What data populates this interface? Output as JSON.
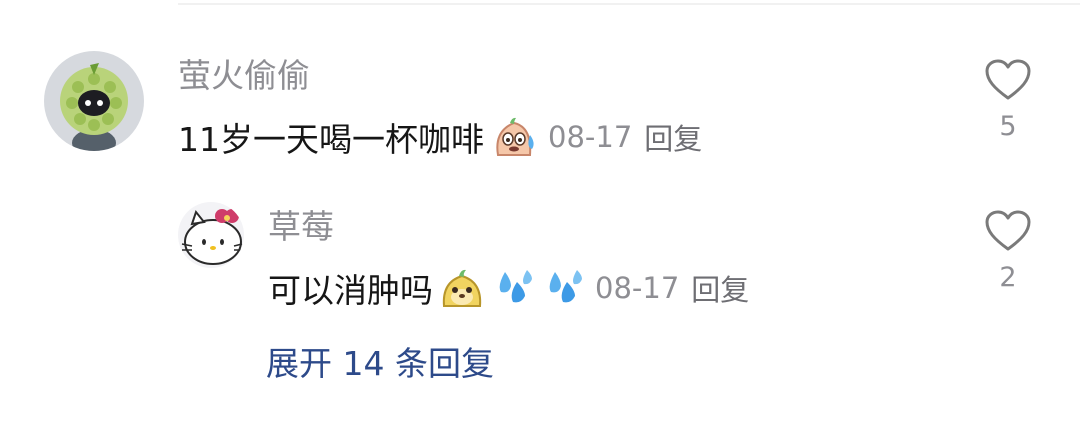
{
  "comment": {
    "username": "萤火偷偷",
    "text": "11岁一天喝一杯咖啡",
    "emoji": "sweat-face-emoji",
    "date": "08-17",
    "reply_label": "回复",
    "like_count": "5"
  },
  "reply": {
    "username": "草莓",
    "text": "可以消肿吗",
    "emojis": [
      "dog-face-emoji",
      "sweat-drops-emoji",
      "sweat-drops-emoji"
    ],
    "date": "08-17",
    "reply_label": "回复",
    "like_count": "2"
  },
  "expand_label": "展开 14 条回复",
  "colors": {
    "username": "#8e8e93",
    "text": "#161616",
    "link": "#2d4a8a",
    "divider": "#f1f1f1"
  }
}
